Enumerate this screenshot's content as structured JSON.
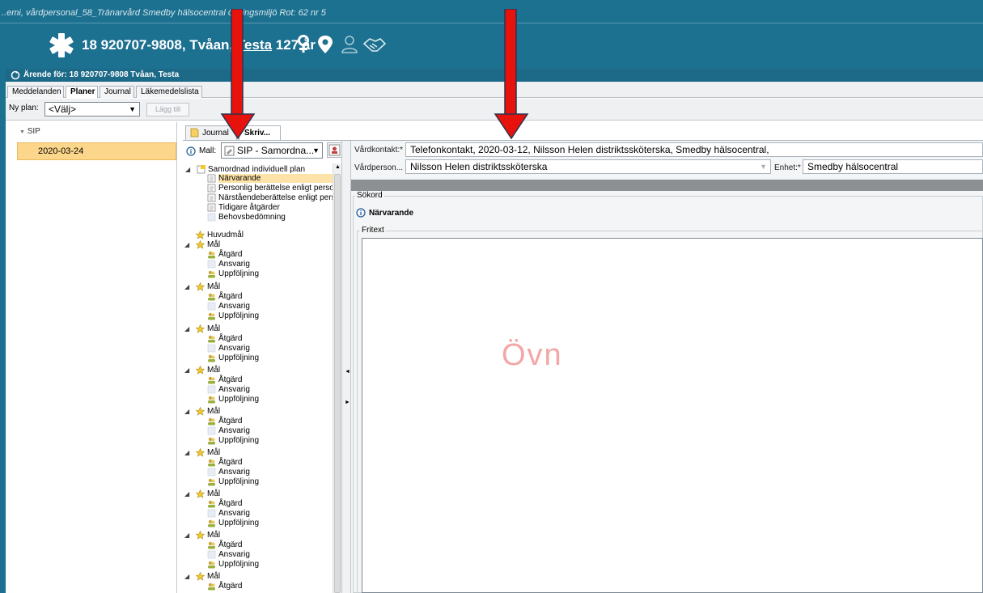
{
  "window": {
    "breadcrumb": "..emi, vårdpersonal_58_Tränarvård Smedby hälsocentral övningsmiljö Rot: 62 nr 5"
  },
  "patient": {
    "id": "18 920707-9808,",
    "surname": "Tvåan,",
    "firstname": "Testa",
    "age": "127 år",
    "icons": [
      "female-icon",
      "location-pin-icon",
      "person-outline-icon",
      "handshake-icon"
    ]
  },
  "case": {
    "title": "Ärende för: 18 920707-9808 Tvåan, Testa"
  },
  "main_tabs": [
    {
      "label": "Meddelanden",
      "active": false
    },
    {
      "label": "Planer",
      "active": true
    },
    {
      "label": "Journal",
      "active": false
    },
    {
      "label": "Läkemedelslista",
      "active": false
    }
  ],
  "toolbar": {
    "new_plan_label": "Ny plan:",
    "new_plan_value": "<Välj>",
    "add_label": "Lägg till"
  },
  "sip_list": {
    "header": "SIP",
    "selected_date": "2020-03-24"
  },
  "sub_tabs": [
    {
      "label": "Journal",
      "active": false
    },
    {
      "label": "Skriv...",
      "active": true
    }
  ],
  "template": {
    "label": "Mall:",
    "value": "SIP - Samordna..."
  },
  "tree": {
    "root": "Samordnad individuell plan",
    "root_children": [
      "Närvarande",
      "Personlig berättelse enligt person",
      "Närståendeberättelse enligt pers",
      "Tidigare åtgärder",
      "Behovsbedömning"
    ],
    "main_goal": "Huvudmål",
    "goal_label": "Mål",
    "goal_children": [
      "Åtgärd",
      "Ansvarig",
      "Uppföljning"
    ]
  },
  "form": {
    "contact_label": "Vårdkontakt:*",
    "contact_value": "Telefonkontakt, 2020-03-12, Nilsson Helen distriktssköterska, Smedby hälsocentral,",
    "staff_label": "Vårdperson...",
    "staff_value": "Nilsson Helen distriktssköterska",
    "unit_label": "Enhet:*",
    "unit_value": "Smedby hälsocentral",
    "keyword_legend": "Sökord",
    "keyword_title": "Närvarande",
    "freetext_legend": "Fritext"
  },
  "watermark": "Övn",
  "colors": {
    "header_blue": "#1c7090",
    "selection_orange": "#fcd68a",
    "arrow_red": "#e8120c",
    "watermark_pink": "#f4a6a6"
  }
}
